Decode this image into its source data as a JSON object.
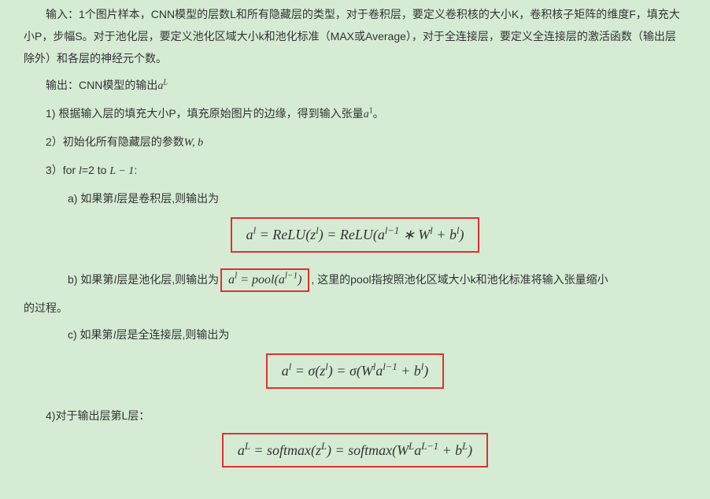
{
  "intro": {
    "p1_a": "输入：1个图片样本，CNN模型的层数L和所有隐藏层的类型，对于卷积层，要定义卷积核的大小K，卷积核子矩阵的维度F，填充大小P，步幅S。对于池化层，要定义池化区域大小k和池化标准（MAX或Average），对于全连接层，要定义全连接层的激活函数（输出层除外）和各层的神经元个数。"
  },
  "output_line": {
    "pre": "输出：CNN模型的输出",
    "math": "a",
    "sup": "L"
  },
  "step1": {
    "pre": "1) 根据输入层的填充大小P，填充原始图片的边缘，得到输入张量",
    "math": "a",
    "sup": "1",
    "post": "。"
  },
  "step2": {
    "pre": "2）初始化所有隐藏层的参数",
    "math": "W, b"
  },
  "step3": {
    "pre": "3）for ",
    "var": "l",
    "mid": "=2 to  ",
    "expr": "L − 1",
    "post": ":"
  },
  "step3a": {
    "pre": "a) 如果第",
    "var": "l",
    "post": "层是卷积层,则输出为"
  },
  "formula_a": {
    "text_parts": {
      "a": "a",
      "l": "l",
      "eq": " = ",
      "relu": "ReLU",
      "lp": "(",
      "z": "z",
      "rp": ")",
      "eq2": " = ",
      "relu2": "ReLU",
      "lp2": "(",
      "a2": "a",
      "lm1": "l−1",
      "star": " ∗ ",
      "W": "W",
      "plus": " + ",
      "b": "b",
      "rp2": ")"
    }
  },
  "step3b": {
    "pre": "b) 如果第",
    "var": "l",
    "mid": "层是池化层,则输出为",
    "formula": {
      "a": "a",
      "l": "l",
      "eq": " = ",
      "pool": "pool",
      "lp": "(",
      "a2": "a",
      "lm1": "l−1",
      "rp": ")"
    },
    "post_a": ", 这里的pool指按照池化区域大小k和池化标准将输入张量缩小",
    "post_b": "的过程。"
  },
  "step3c": {
    "pre": "c) 如果第",
    "var": "l",
    "post": "层是全连接层,则输出为"
  },
  "formula_c": {
    "a": "a",
    "l": "l",
    "eq": " = ",
    "sigma": "σ",
    "lp": "(",
    "z": "z",
    "rp": ")",
    "eq2": " = ",
    "sigma2": "σ",
    "lp2": "(",
    "W": "W",
    "a2": "a",
    "lm1": "l−1",
    "plus": " + ",
    "b": "b",
    "rp2": ")"
  },
  "step4": {
    "text": "4)对于输出层第L层："
  },
  "formula_d": {
    "a": "a",
    "L": "L",
    "eq": " = ",
    "sm": "softmax",
    "lp": "(",
    "z": "z",
    "rp": ")",
    "eq2": " = ",
    "sm2": "softmax",
    "lp2": "(",
    "W": "W",
    "a2": "a",
    "Lm1": "L−1",
    "plus": " + ",
    "b": "b",
    "rp2": ")"
  }
}
